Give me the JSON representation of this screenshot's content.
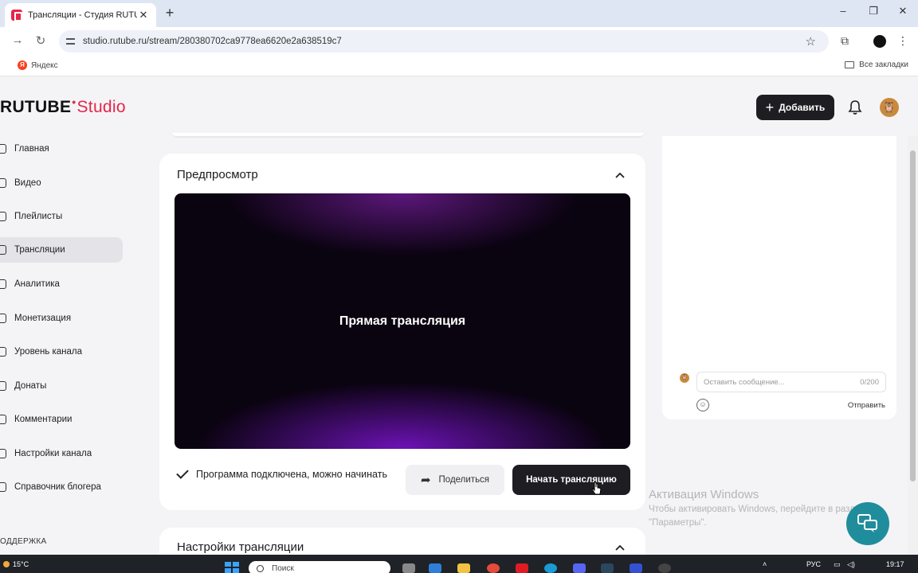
{
  "browser": {
    "tab_title": "Трансляции - Студия RUTUBE",
    "tab_close": "✕",
    "new_tab": "+",
    "url": "studio.rutube.ru/stream/280380702ca9778ea6620e2a638519c7",
    "bookmarks": {
      "yandex": "Яндекс",
      "yandex_icon": "Я",
      "all": "Все закладки"
    },
    "window_controls": {
      "minimize": "–",
      "restore": "❐",
      "close": "✕"
    }
  },
  "header": {
    "logo_main": "RUTUBE",
    "logo_dot": "•",
    "logo_studio": "Studio",
    "add_button": "Добавить",
    "add_icon": "+"
  },
  "sidebar": {
    "items": [
      {
        "label": "Главная",
        "icon": "home-icon"
      },
      {
        "label": "Видео",
        "icon": "video-icon"
      },
      {
        "label": "Плейлисты",
        "icon": "playlist-icon"
      },
      {
        "label": "Трансляции",
        "icon": "broadcast-icon",
        "active": true
      },
      {
        "label": "Аналитика",
        "icon": "analytics-icon"
      },
      {
        "label": "Монетизация",
        "icon": "ruble-icon"
      },
      {
        "label": "Уровень канала",
        "icon": "level-icon"
      },
      {
        "label": "Донаты",
        "icon": "donate-icon"
      },
      {
        "label": "Комментарии",
        "icon": "comments-icon"
      },
      {
        "label": "Настройки канала",
        "icon": "settings-icon"
      },
      {
        "label": "Справочник блогера",
        "icon": "guide-icon"
      }
    ],
    "support": "ОДДЕРЖКА"
  },
  "preview": {
    "title": "Предпросмотр",
    "video_label": "Прямая трансляция",
    "status": "Программа подключена, можно начинать",
    "share_button": "Поделиться",
    "start_button": "Начать трансляцию"
  },
  "settings_card": {
    "title": "Настройки трансляции"
  },
  "chat": {
    "placeholder": "Оставить сообщение...",
    "counter": "0/200",
    "send": "Отправить"
  },
  "activation": {
    "title": "Активация Windows",
    "line1": "Чтобы активировать Windows, перейдите в раздел",
    "line2": "\"Параметры\"."
  },
  "taskbar": {
    "weather": "15°C",
    "search": "Поиск",
    "lang": "РУС",
    "time": "19:17"
  },
  "colors": {
    "brand": "#e6254b",
    "dark_button": "#1e1e22",
    "help": "#1f8d9c"
  }
}
